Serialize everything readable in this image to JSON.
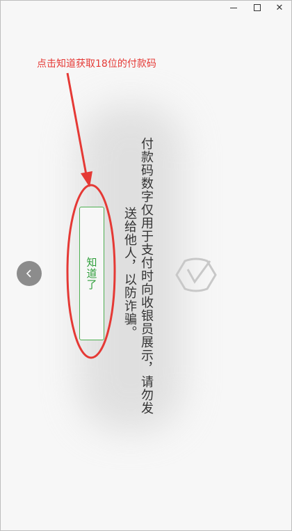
{
  "window": {
    "minimize_icon": "minimize-icon",
    "maximize_icon": "maximize-icon",
    "close_icon": "close-icon",
    "close_glyph": "✕"
  },
  "annotation": {
    "text": "点击知道获取18位的付款码",
    "color": "#e53935"
  },
  "dialog": {
    "message_line1": "付款码数字仅用于支付时向收银员展示，请勿发",
    "message_line2": "送给他人，以防诈骗。",
    "confirm_label": "知道了",
    "confirm_color": "#2e9e3a",
    "icon": "shield-check-icon"
  },
  "nav": {
    "back_icon": "chevron-left-icon"
  }
}
